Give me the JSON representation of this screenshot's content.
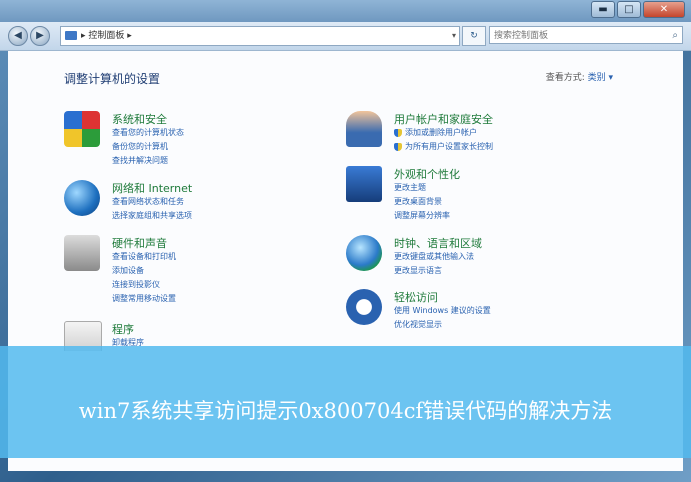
{
  "window": {
    "minimize": "▬",
    "maximize": "□",
    "close": "✕"
  },
  "nav": {
    "back": "◀",
    "forward": "▶",
    "address": "▸ 控制面板 ▸",
    "refresh": "↻",
    "search_placeholder": "搜索控制面板"
  },
  "page": {
    "heading": "调整计算机的设置",
    "view_by_label": "查看方式:",
    "view_by_value": "类别 ▾"
  },
  "left_categories": [
    {
      "title": "系统和安全",
      "icon": "shield-flag-icon",
      "links": [
        "查看您的计算机状态",
        "备份您的计算机",
        "查找并解决问题"
      ]
    },
    {
      "title": "网络和 Internet",
      "icon": "network-globe-icon",
      "links": [
        "查看网络状态和任务",
        "选择家庭组和共享选项"
      ]
    },
    {
      "title": "硬件和声音",
      "icon": "printer-icon",
      "links": [
        "查看设备和打印机",
        "添加设备",
        "连接到投影仪",
        "调整常用移动设置"
      ]
    },
    {
      "title": "程序",
      "icon": "programs-icon",
      "links": [
        "卸载程序"
      ]
    }
  ],
  "right_categories": [
    {
      "title": "用户帐户和家庭安全",
      "icon": "users-icon",
      "links": [
        "添加或删除用户帐户",
        "为所有用户设置家长控制"
      ]
    },
    {
      "title": "外观和个性化",
      "icon": "appearance-icon",
      "links": [
        "更改主题",
        "更改桌面背景",
        "调整屏幕分辨率"
      ]
    },
    {
      "title": "时钟、语言和区域",
      "icon": "clock-globe-icon",
      "links": [
        "更改键盘或其他输入法",
        "更改显示语言"
      ]
    },
    {
      "title": "轻松访问",
      "icon": "ease-of-access-icon",
      "links": [
        "使用 Windows 建议的设置",
        "优化视觉显示"
      ]
    }
  ],
  "banner": {
    "text": "win7系统共享访问提示0x800704cf错误代码的解决方法"
  },
  "colors": {
    "banner": "#52baee",
    "link": "#2a62b0",
    "category_title": "#1e7a3a"
  }
}
